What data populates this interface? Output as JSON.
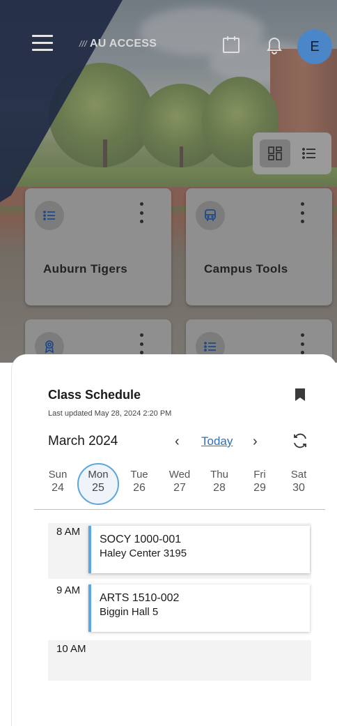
{
  "header": {
    "logo_slashes": "///",
    "logo_text": "AU ACCESS",
    "avatar_initial": "E",
    "icons": [
      "menu-icon",
      "calendar-icon",
      "bell-icon"
    ]
  },
  "view_toggle": {
    "options": [
      "grid-view-icon",
      "list-view-icon"
    ],
    "active": "grid-view-icon"
  },
  "cards": [
    {
      "title": "Auburn Tigers",
      "icon": "list-icon"
    },
    {
      "title": "Campus Tools",
      "icon": "bus-icon"
    },
    {
      "title": "",
      "icon": "award-icon"
    },
    {
      "title": "",
      "icon": "list-icon"
    }
  ],
  "schedule": {
    "title": "Class Schedule",
    "last_updated": "Last updated May 28, 2024 2:20 PM",
    "month": "March 2024",
    "today_label": "Today",
    "prev_label": "‹",
    "next_label": "›",
    "days": [
      {
        "name": "Sun",
        "date": "24"
      },
      {
        "name": "Mon",
        "date": "25"
      },
      {
        "name": "Tue",
        "date": "26"
      },
      {
        "name": "Wed",
        "date": "27"
      },
      {
        "name": "Thu",
        "date": "28"
      },
      {
        "name": "Fri",
        "date": "29"
      },
      {
        "name": "Sat",
        "date": "30"
      }
    ],
    "selected_day": "Mon",
    "slots": [
      {
        "hour": "8 AM",
        "event": {
          "code": "SOCY 1000-001",
          "location": "Haley Center 3195"
        }
      },
      {
        "hour": "9 AM",
        "event": {
          "code": "ARTS 1510-002",
          "location": "Biggin Hall 5"
        }
      },
      {
        "hour": "10 AM"
      }
    ]
  },
  "colors": {
    "accent": "#2f6fb4",
    "event_bar": "#5aa7e4",
    "avatar": "#4a86c8",
    "navy": "#1f2a44"
  }
}
